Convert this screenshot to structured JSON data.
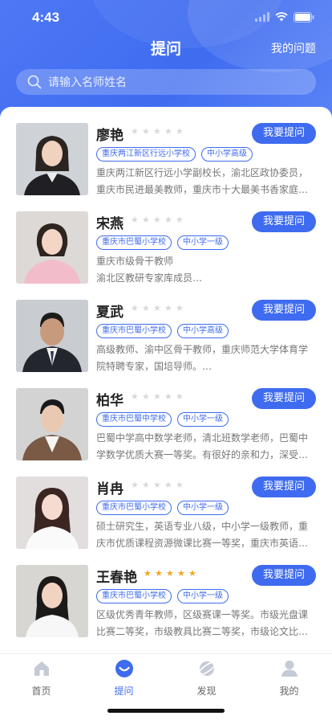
{
  "status_bar": {
    "time": "4:43"
  },
  "nav": {
    "title": "提问",
    "right_action": "我的问题"
  },
  "search": {
    "placeholder": "请输入名师姓名"
  },
  "ask_label": "我要提问",
  "teachers": [
    {
      "name": "廖艳",
      "rating": 0,
      "tags": [
        "重庆两江新区行远小学校",
        "中小学高级"
      ],
      "desc": "重庆两江新区行远小学副校长，渝北区政协委员，重庆市民进最美教师，重庆市十大最美书香家庭…"
    },
    {
      "name": "宋燕",
      "rating": 0,
      "tags": [
        "重庆市巴蜀小学校",
        "中小学一级"
      ],
      "desc": "重庆市级骨干教师\n渝北区教研专家库成员…"
    },
    {
      "name": "夏武",
      "rating": 0,
      "tags": [
        "重庆市巴蜀小学校",
        "中小学高级"
      ],
      "desc": "高级教师、渝中区骨干教师，重庆师范大学体育学院特聘专家，国培导师。…"
    },
    {
      "name": "柏华",
      "rating": 0,
      "tags": [
        "重庆市巴蜀中学校",
        "中小学一级"
      ],
      "desc": "巴蜀中学高中数学老师，清北班数学老师，巴蜀中学数学优质大赛一等奖。有很好的亲和力，深受…"
    },
    {
      "name": "肖冉",
      "rating": 0,
      "tags": [
        "重庆市巴蜀小学校",
        "中小学一级"
      ],
      "desc": "硕士研究生，英语专业八级，中小学一级教师，重庆市优质课程资源微课比赛一等奖，重庆市英语…"
    },
    {
      "name": "王春艳",
      "rating": 5,
      "tags": [
        "重庆市巴蜀小学校",
        "中小学一级"
      ],
      "desc": "区级优秀青年教师，区级赛课一等奖。市级光盘课比赛二等奖，市级教具比赛二等奖，市级论文比…"
    }
  ],
  "tabbar": [
    {
      "label": "首页",
      "icon": "home-icon",
      "active": false
    },
    {
      "label": "提问",
      "icon": "question-smile-icon",
      "active": true
    },
    {
      "label": "发现",
      "icon": "discover-planet-icon",
      "active": false
    },
    {
      "label": "我的",
      "icon": "profile-icon",
      "active": false
    }
  ],
  "colors": {
    "primary": "#3e6bef",
    "star_on": "#f6a623",
    "star_off": "#d8d8d8"
  }
}
